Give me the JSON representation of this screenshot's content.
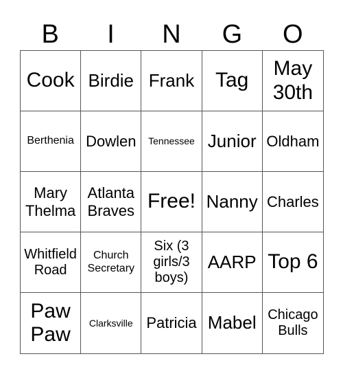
{
  "header": [
    "B",
    "I",
    "N",
    "G",
    "O"
  ],
  "cells": [
    [
      "Cook",
      "Birdie",
      "Frank",
      "Tag",
      "May 30th"
    ],
    [
      "Berthenia",
      "Dowlen",
      "Tennessee",
      "Junior",
      "Oldham"
    ],
    [
      "Mary Thelma",
      "Atlanta Braves",
      "Free!",
      "Nanny",
      "Charles"
    ],
    [
      "Whitfield Road",
      "Church Secretary",
      "Six (3 girls/3 boys)",
      "AARP",
      "Top 6"
    ],
    [
      "Paw Paw",
      "Clarksville",
      "Patricia",
      "Mabel",
      "Chicago Bulls"
    ]
  ]
}
